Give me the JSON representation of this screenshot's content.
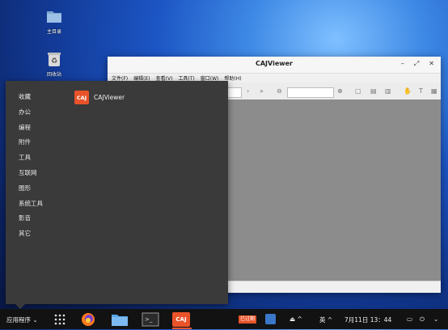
{
  "desktop": {
    "icons": [
      {
        "label": "主目录",
        "icon": "folder-icon"
      },
      {
        "label": "回收站",
        "icon": "trash-icon"
      }
    ]
  },
  "window": {
    "title": "CAJViewer",
    "controls": [
      "–",
      "⤢",
      "✕"
    ],
    "menu": [
      "文件(F)",
      "编辑(E)",
      "查看(V)",
      "工具(T)",
      "窗口(W)",
      "帮助(H)"
    ]
  },
  "app_menu": {
    "categories": [
      "收藏",
      "办公",
      "编程",
      "附件",
      "工具",
      "互联网",
      "图形",
      "系统工具",
      "影音",
      "其它"
    ],
    "apps": [
      {
        "name": "CAJViewer",
        "logo_text": "CAJ"
      }
    ]
  },
  "taskbar": {
    "start_label": "应用程序",
    "dock": [
      "apps-grid",
      "firefox",
      "file-manager",
      "terminal",
      "cajviewer"
    ],
    "dock_active": "cajviewer",
    "tray_badge": "已过期",
    "ime": "英",
    "clock": "7月11日 13：44",
    "colors": {
      "bg": "#121212",
      "accent": "#e8532a",
      "badge": "#e8532a"
    }
  }
}
